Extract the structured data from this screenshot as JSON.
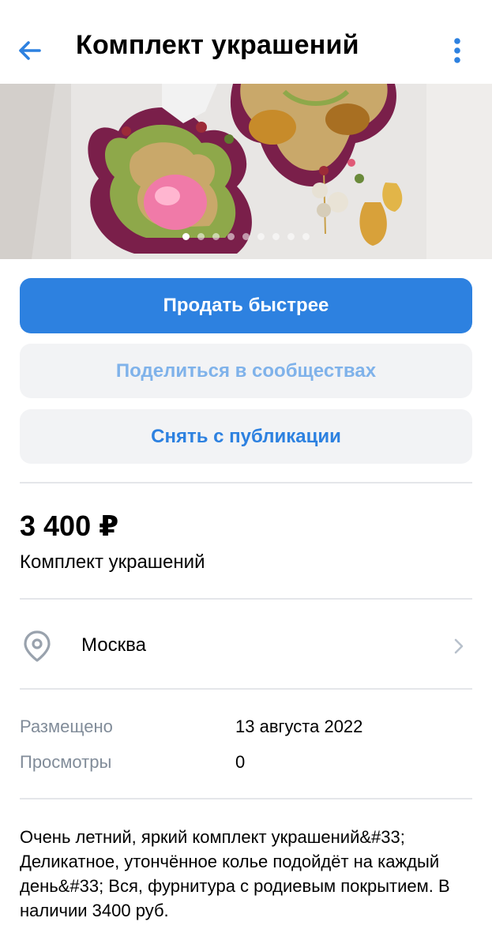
{
  "header": {
    "title": "Комплект украшений",
    "back_icon": "arrow-left-icon",
    "more_icon": "more-vertical-icon",
    "accent_color": "#2d81e0"
  },
  "gallery": {
    "photo_count": 9,
    "active_index": 1
  },
  "actions": {
    "sell_faster": "Продать быстрее",
    "share_communities": "Поделиться в сообществах",
    "unpublish": "Снять с публикации"
  },
  "listing": {
    "price": "3 400 ₽",
    "name": "Комплект украшений"
  },
  "location": {
    "icon": "location-pin-icon",
    "city": "Москва",
    "chevron_icon": "chevron-right-icon"
  },
  "meta": {
    "posted_label": "Размещено",
    "posted_value": "13 августа 2022",
    "views_label": "Просмотры",
    "views_value": "0"
  },
  "description": "Очень летний, яркий комплект украшений&#33; Деликатное, утончённое колье подойдёт на каждый день&#33; Вся, фурнитура с родиевым покрытием. В наличии 3400 руб."
}
